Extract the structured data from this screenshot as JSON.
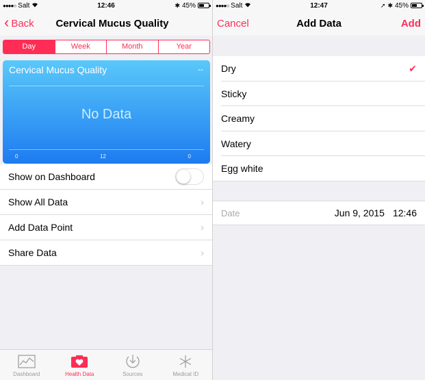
{
  "left": {
    "status": {
      "carrier": "Salt",
      "time": "12:46",
      "battery": "45%",
      "battery_level": 0.45
    },
    "nav": {
      "back": "Back",
      "title": "Cervical Mucus Quality"
    },
    "segments": [
      "Day",
      "Week",
      "Month",
      "Year"
    ],
    "active_segment": "Day",
    "chart": {
      "title": "Cervical Mucus Quality",
      "dash": "--",
      "no_data": "No Data",
      "axis_left": "0",
      "axis_mid": "12",
      "axis_right": "0"
    },
    "rows": [
      {
        "label": "Show on Dashboard",
        "toggle": false
      },
      {
        "label": "Show All Data"
      },
      {
        "label": "Add Data Point"
      },
      {
        "label": "Share Data"
      }
    ],
    "tabs": [
      {
        "label": "Dashboard",
        "icon": "dashboard-icon"
      },
      {
        "label": "Health Data",
        "icon": "health-data-icon",
        "active": true
      },
      {
        "label": "Sources",
        "icon": "sources-icon"
      },
      {
        "label": "Medical ID",
        "icon": "medical-id-icon"
      }
    ]
  },
  "right": {
    "status": {
      "carrier": "Salt",
      "time": "12:47",
      "battery": "45%",
      "battery_level": 0.45
    },
    "nav": {
      "cancel": "Cancel",
      "title": "Add Data",
      "add": "Add"
    },
    "options": [
      {
        "label": "Dry",
        "selected": true
      },
      {
        "label": "Sticky"
      },
      {
        "label": "Creamy"
      },
      {
        "label": "Watery"
      },
      {
        "label": "Egg white"
      }
    ],
    "date": {
      "label": "Date",
      "date": "Jun 9, 2015",
      "time": "12:46"
    }
  },
  "colors": {
    "accent": "#ff2d55",
    "chart_top": "#5ac8fa",
    "chart_bottom": "#1d7bf0"
  }
}
